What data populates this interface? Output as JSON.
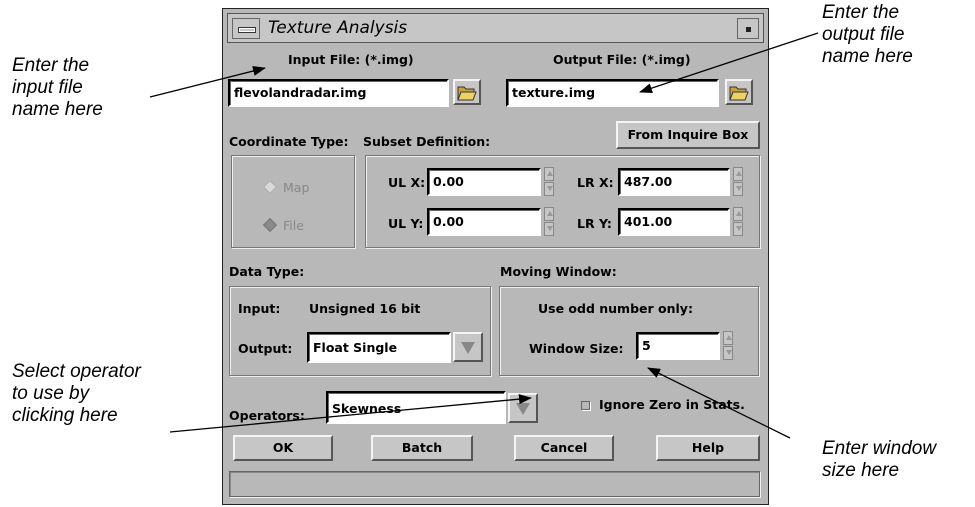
{
  "callouts": {
    "input": "Enter the\ninput file\nname here",
    "output": "Enter the\noutput file\nname here",
    "operator": "Select operator\nto use by\nclicking here",
    "window": "Enter window\nsize here"
  },
  "dialog": {
    "title": "Texture Analysis",
    "input_file_label": "Input File: (*.img)",
    "input_file_value": "flevolandradar.img",
    "output_file_label": "Output File: (*.img)",
    "output_file_value": "texture.img",
    "coordinate_type_label": "Coordinate Type:",
    "subset_definition_label": "Subset Definition:",
    "from_inquire_box_label": "From Inquire Box",
    "coord_options": [
      "Map",
      "File"
    ],
    "coord_selected": "File",
    "ulx_label": "UL X:",
    "ulx_value": "0.00",
    "uly_label": "UL Y:",
    "uly_value": "0.00",
    "lrx_label": "LR X:",
    "lrx_value": "487.00",
    "lry_label": "LR Y:",
    "lry_value": "401.00",
    "data_type_label": "Data Type:",
    "input_type_label": "Input:",
    "input_type_value": "Unsigned 16 bit",
    "output_type_label": "Output:",
    "output_type_value": "Float Single",
    "moving_window_label": "Moving Window:",
    "odd_note": "Use odd number only:",
    "window_size_label": "Window Size:",
    "window_size_value": "5",
    "operators_label": "Operators:",
    "operators_value": "Skewness",
    "ignore_zero_label": "Ignore Zero in Stats.",
    "ignore_zero_checked": false,
    "buttons": {
      "ok": "OK",
      "batch": "Batch",
      "cancel": "Cancel",
      "help": "Help"
    },
    "status_text": ""
  },
  "colors": {
    "dialog_bg": "#c6c6c6",
    "field_bg": "#ffffff",
    "disabled_text": "#888888"
  },
  "icons": {
    "folder": "folder-open-icon",
    "dropdown": "chevron-down-icon"
  }
}
